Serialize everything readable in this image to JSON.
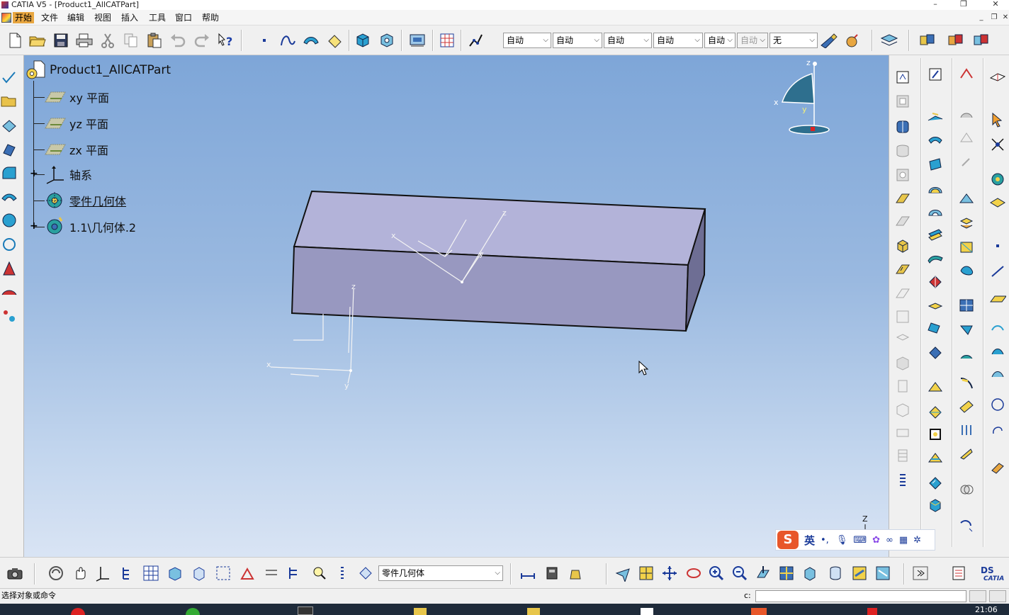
{
  "window": {
    "title": "CATIA V5 - [Product1_AllCATPart]",
    "min": "–",
    "max": "❐",
    "close": "✕"
  },
  "menu": {
    "items": [
      "开始",
      "文件",
      "编辑",
      "视图",
      "插入",
      "工具",
      "窗口",
      "帮助"
    ],
    "active": "开始",
    "mdi_min": "_",
    "mdi_max": "❐",
    "mdi_close": "✕"
  },
  "toolbar": {
    "combos": [
      {
        "value": "自动"
      },
      {
        "value": "自动"
      },
      {
        "value": "自动"
      },
      {
        "value": "自动"
      },
      {
        "value": "自动"
      },
      {
        "value": "自动"
      },
      {
        "value": "无"
      }
    ]
  },
  "tree": {
    "root": "Product1_AllCATPart",
    "nodes": [
      {
        "label": "xy 平面",
        "icon": "plane-icon"
      },
      {
        "label": "yz 平面",
        "icon": "plane-icon"
      },
      {
        "label": "zx 平面",
        "icon": "plane-icon"
      },
      {
        "label": "轴系",
        "icon": "axis-system-icon",
        "expandable": true
      },
      {
        "label": "零件几何体",
        "icon": "part-body-icon",
        "underlined": true
      },
      {
        "label": "1.1\\几何体.2",
        "icon": "body-icon",
        "expandable": true
      }
    ]
  },
  "viewport": {
    "compass_labels": {
      "x": "x",
      "y": "y",
      "z": "z"
    },
    "axis1_labels": {
      "x": "x",
      "y": "y",
      "z": "z"
    },
    "axis2_labels": {
      "x": "x",
      "y": "y",
      "z": "z"
    },
    "corner_axis_label": "Z",
    "colors": {
      "solid_top": "#b3b3d9",
      "solid_front": "#9898c0",
      "solid_side": "#6e6e94",
      "edge": "#111111",
      "axis": "#f4f4f4"
    }
  },
  "bottom": {
    "current_body": "零件几何体"
  },
  "ime": {
    "lang": "英",
    "logo": "S"
  },
  "status": {
    "prompt": "选择对象或命令",
    "cmd_label": "c:",
    "cmd_value": ""
  },
  "taskbar": {
    "time": "21:06"
  }
}
